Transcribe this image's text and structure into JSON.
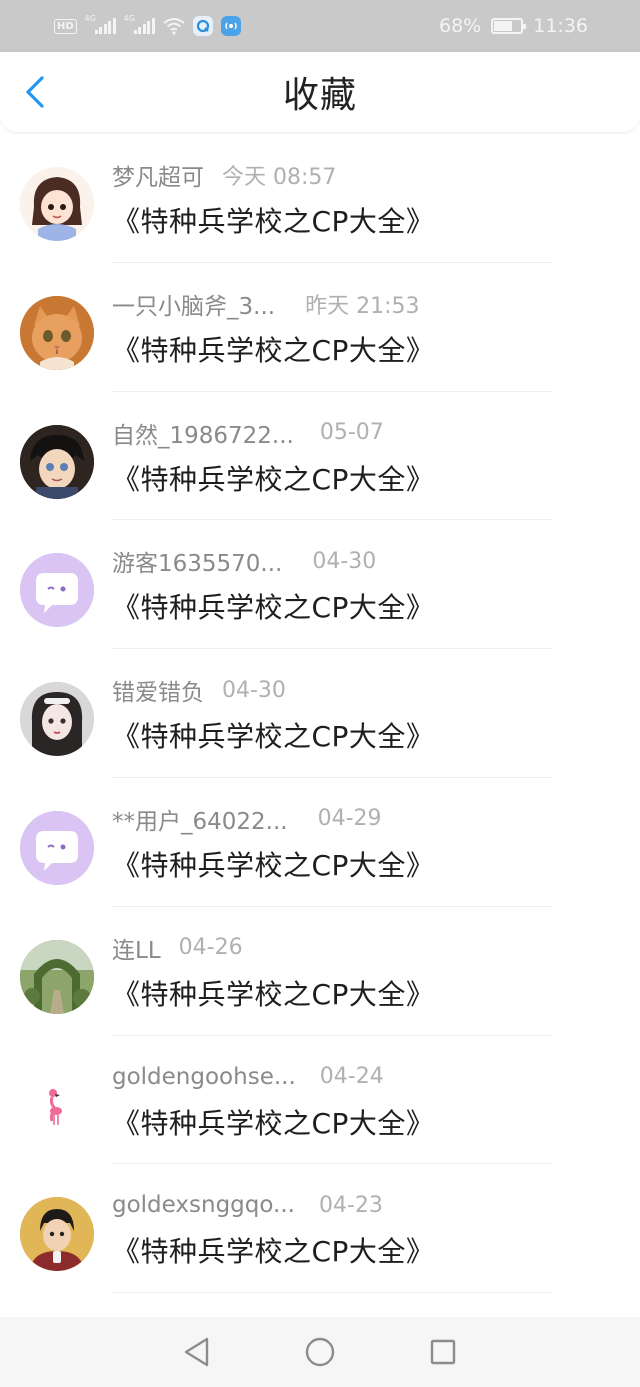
{
  "status_bar": {
    "network_left": "4G",
    "network_right": "4G",
    "battery_percent": "68%",
    "battery_level": 0.68,
    "time": "11:36",
    "icons": [
      "hd-icon",
      "signal-icon",
      "signal-icon",
      "wifi-icon",
      "app-notification-icon",
      "app-notification-icon",
      "battery-icon"
    ]
  },
  "header": {
    "title": "收藏",
    "back_icon": "chevron-left-icon",
    "accent_color": "#2196f3"
  },
  "favorites": [
    {
      "username": "梦凡超可",
      "time": "今天 08:57",
      "title": "《特种兵学校之CP大全》",
      "avatar": "girl-cartoon"
    },
    {
      "username": "一只小脑斧_3...",
      "time": "昨天 21:53",
      "title": "《特种兵学校之CP大全》",
      "avatar": "orange-cat"
    },
    {
      "username": "自然_1986722...",
      "time": "05-07",
      "title": "《特种兵学校之CP大全》",
      "avatar": "anime-detective"
    },
    {
      "username": "游客1635570...",
      "time": "04-30",
      "title": "《特种兵学校之CP大全》",
      "avatar": "default-chat-bubble"
    },
    {
      "username": "错爱错负",
      "time": "04-30",
      "title": "《特种兵学校之CP大全》",
      "avatar": "girl-portrait"
    },
    {
      "username": "**用户_64022...",
      "time": "04-29",
      "title": "《特种兵学校之CP大全》",
      "avatar": "default-chat-bubble"
    },
    {
      "username": "连LL",
      "time": "04-26",
      "title": "《特种兵学校之CP大全》",
      "avatar": "garden-arch"
    },
    {
      "username": "goldengoohse...",
      "time": "04-24",
      "title": "《特种兵学校之CP大全》",
      "avatar": "pink-flamingo"
    },
    {
      "username": "goldexsnggqo...",
      "time": "04-23",
      "title": "《特种兵学校之CP大全》",
      "avatar": "boy-photo"
    }
  ],
  "system_nav": {
    "icons": [
      "back-triangle-icon",
      "home-circle-icon",
      "recents-square-icon"
    ]
  }
}
